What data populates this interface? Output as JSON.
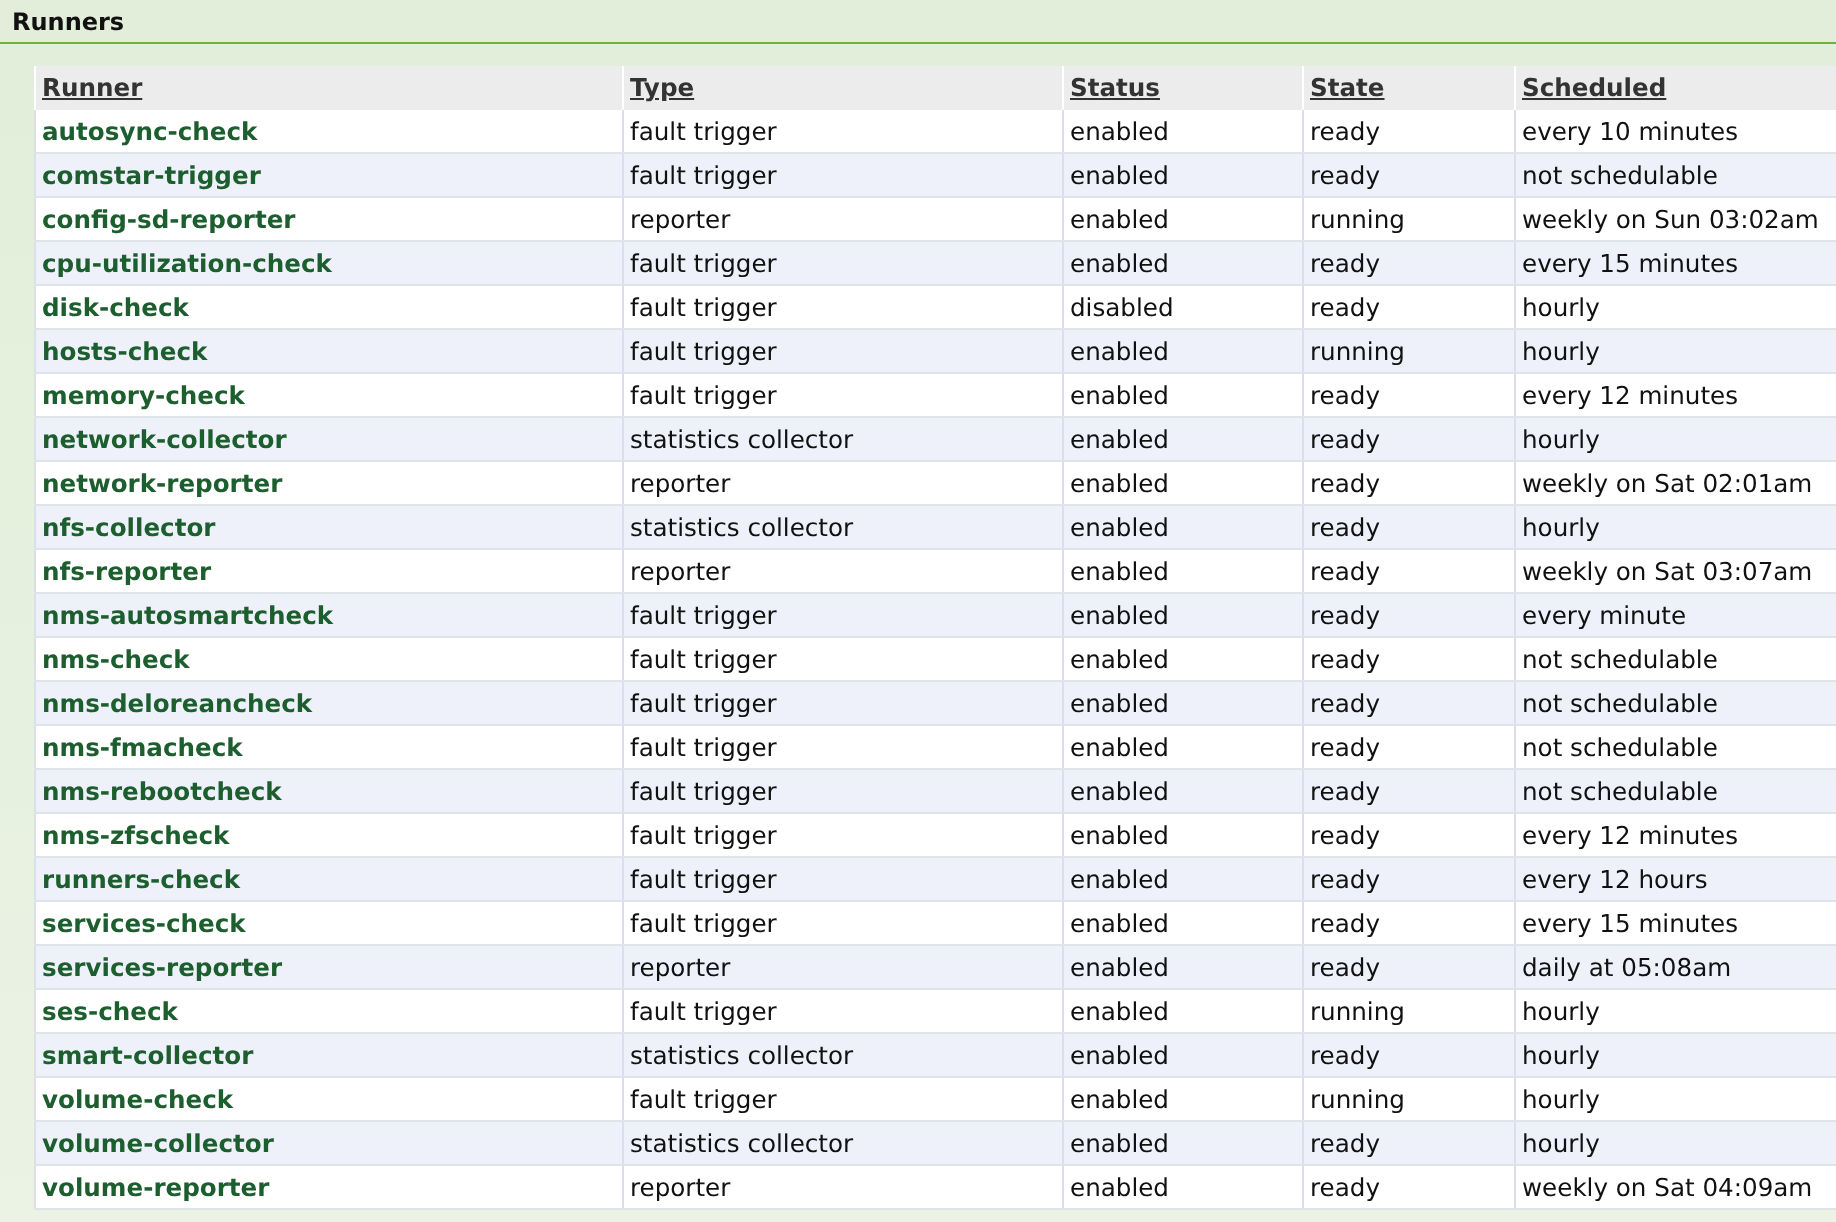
{
  "panel": {
    "title": "Runners"
  },
  "table": {
    "columns": [
      "Runner",
      "Type",
      "Status",
      "State",
      "Scheduled"
    ],
    "rows": [
      [
        "autosync-check",
        "fault trigger",
        "enabled",
        "ready",
        "every 10 minutes"
      ],
      [
        "comstar-trigger",
        "fault trigger",
        "enabled",
        "ready",
        "not schedulable"
      ],
      [
        "config-sd-reporter",
        "reporter",
        "enabled",
        "running",
        "weekly on Sun 03:02am"
      ],
      [
        "cpu-utilization-check",
        "fault trigger",
        "enabled",
        "ready",
        "every 15 minutes"
      ],
      [
        "disk-check",
        "fault trigger",
        "disabled",
        "ready",
        "hourly"
      ],
      [
        "hosts-check",
        "fault trigger",
        "enabled",
        "running",
        "hourly"
      ],
      [
        "memory-check",
        "fault trigger",
        "enabled",
        "ready",
        "every 12 minutes"
      ],
      [
        "network-collector",
        "statistics collector",
        "enabled",
        "ready",
        "hourly"
      ],
      [
        "network-reporter",
        "reporter",
        "enabled",
        "ready",
        "weekly on Sat 02:01am"
      ],
      [
        "nfs-collector",
        "statistics collector",
        "enabled",
        "ready",
        "hourly"
      ],
      [
        "nfs-reporter",
        "reporter",
        "enabled",
        "ready",
        "weekly on Sat 03:07am"
      ],
      [
        "nms-autosmartcheck",
        "fault trigger",
        "enabled",
        "ready",
        "every minute"
      ],
      [
        "nms-check",
        "fault trigger",
        "enabled",
        "ready",
        "not schedulable"
      ],
      [
        "nms-deloreancheck",
        "fault trigger",
        "enabled",
        "ready",
        "not schedulable"
      ],
      [
        "nms-fmacheck",
        "fault trigger",
        "enabled",
        "ready",
        "not schedulable"
      ],
      [
        "nms-rebootcheck",
        "fault trigger",
        "enabled",
        "ready",
        "not schedulable"
      ],
      [
        "nms-zfscheck",
        "fault trigger",
        "enabled",
        "ready",
        "every 12 minutes"
      ],
      [
        "runners-check",
        "fault trigger",
        "enabled",
        "ready",
        "every 12 hours"
      ],
      [
        "services-check",
        "fault trigger",
        "enabled",
        "ready",
        "every 15 minutes"
      ],
      [
        "services-reporter",
        "reporter",
        "enabled",
        "ready",
        "daily at 05:08am"
      ],
      [
        "ses-check",
        "fault trigger",
        "enabled",
        "running",
        "hourly"
      ],
      [
        "smart-collector",
        "statistics collector",
        "enabled",
        "ready",
        "hourly"
      ],
      [
        "volume-check",
        "fault trigger",
        "enabled",
        "running",
        "hourly"
      ],
      [
        "volume-collector",
        "statistics collector",
        "enabled",
        "ready",
        "hourly"
      ],
      [
        "volume-reporter",
        "reporter",
        "enabled",
        "ready",
        "weekly on Sat 04:09am"
      ]
    ]
  }
}
